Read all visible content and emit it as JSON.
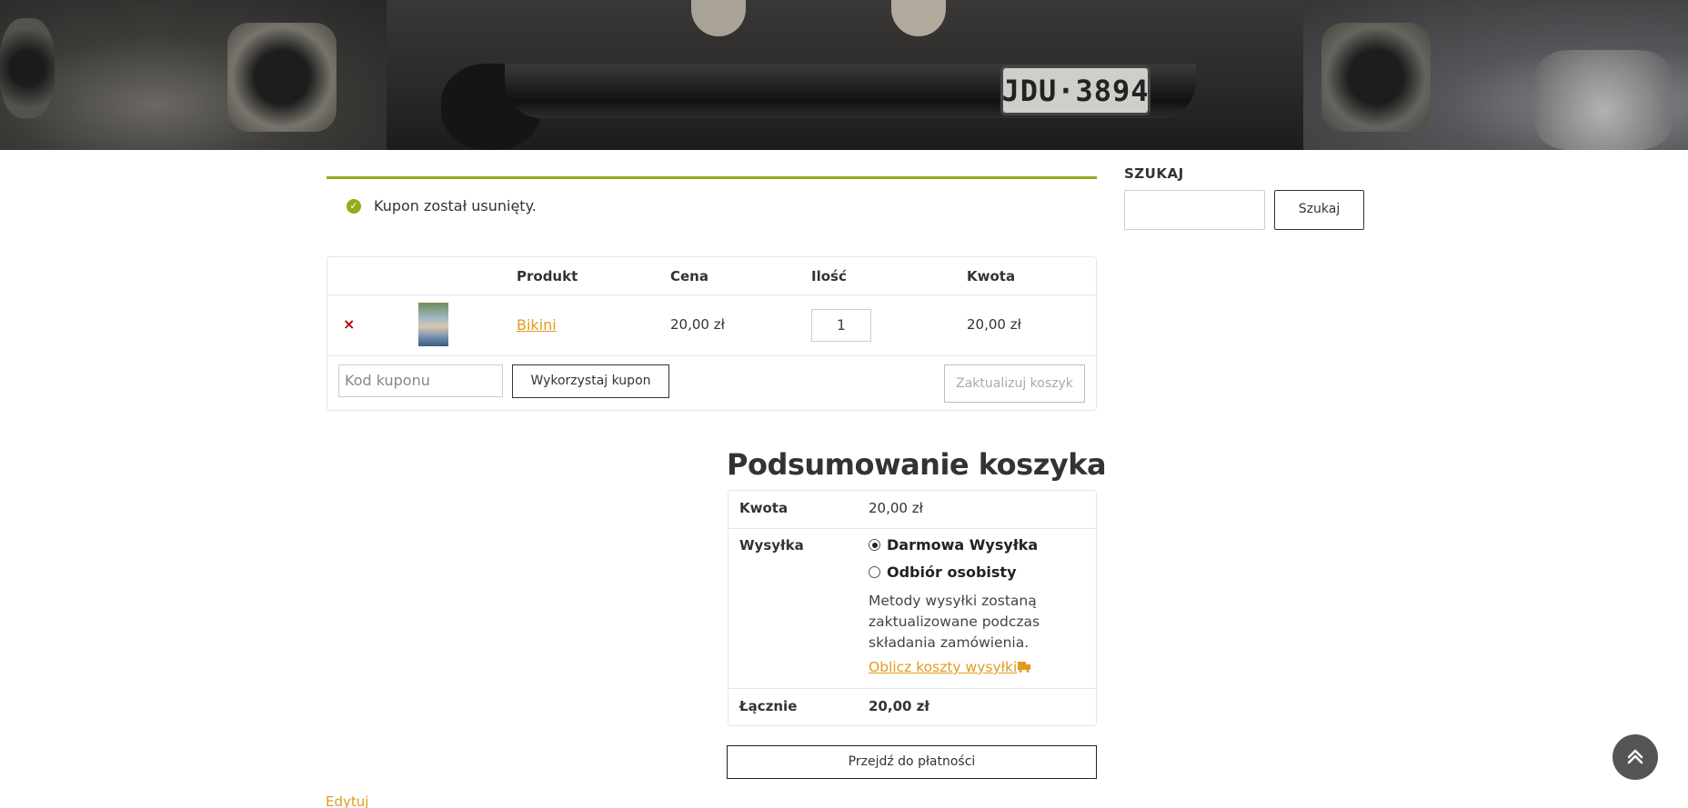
{
  "hero": {
    "plate_text": "JDU·3894"
  },
  "notice": {
    "message": "Kupon został usunięty.",
    "icon": "check-circle-icon",
    "color": "#8fae1b"
  },
  "cart": {
    "columns": [
      "",
      "",
      "Produkt",
      "Cena",
      "Ilość",
      "Kwota"
    ],
    "items": [
      {
        "remove_symbol": "×",
        "product": "Bikini",
        "price": "20,00 zł",
        "quantity": "1",
        "subtotal": "20,00 zł"
      }
    ],
    "coupon_placeholder": "Kod kuponu",
    "apply_coupon_label": "Wykorzystaj kupon",
    "update_cart_label": "Zaktualizuj koszyk"
  },
  "sidebar": {
    "search_title": "SZUKAJ",
    "search_button": "Szukaj"
  },
  "totals": {
    "title": "Podsumowanie koszyka",
    "subtotal_label": "Kwota",
    "subtotal_value": "20,00 zł",
    "shipping_label": "Wysyłka",
    "shipping_options": [
      {
        "label": "Darmowa Wysyłka",
        "checked": true
      },
      {
        "label": "Odbiór osobisty",
        "checked": false
      }
    ],
    "shipping_note": "Metody wysyłki zostaną zaktualizowane podczas składania zamówienia.",
    "calc_shipping_label": "Oblicz koszty wysyłki",
    "total_label": "Łącznie",
    "total_value": "20,00 zł",
    "checkout_label": "Przejdź do płatności"
  },
  "footer": {
    "edit_label": "Edytuj"
  },
  "colors": {
    "accent": "#e29a1f",
    "success": "#8fae1b"
  }
}
